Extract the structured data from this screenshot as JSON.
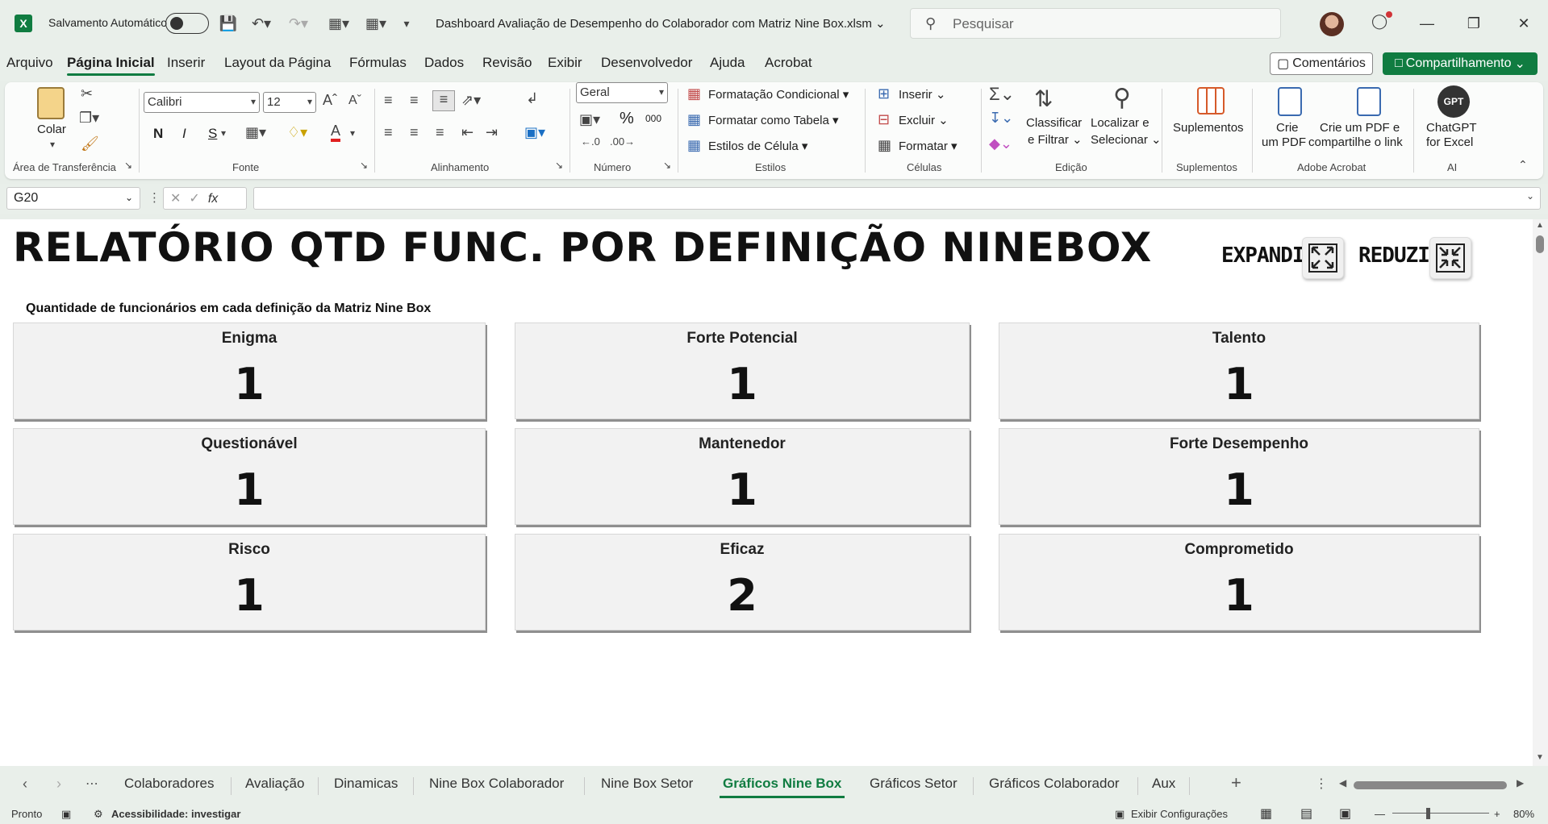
{
  "titlebar": {
    "autosave_label": "Salvamento Automático",
    "document_title": "Dashboard Avaliação de Desempenho do Colaborador com Matriz Nine Box.xlsm",
    "search_placeholder": "Pesquisar"
  },
  "menu": {
    "items": [
      "Arquivo",
      "Página Inicial",
      "Inserir",
      "Layout da Página",
      "Fórmulas",
      "Dados",
      "Revisão",
      "Exibir",
      "Desenvolvedor",
      "Ajuda",
      "Acrobat"
    ],
    "active": "Página Inicial",
    "comments_label": "Comentários",
    "share_label": "Compartilhamento"
  },
  "ribbon": {
    "clipboard": {
      "paste_label": "Colar",
      "group_label": "Área de Transferência"
    },
    "font": {
      "font_name": "Calibri",
      "font_size": "12",
      "bold": "N",
      "italic": "I",
      "underline": "S",
      "group_label": "Fonte"
    },
    "alignment": {
      "group_label": "Alinhamento"
    },
    "number": {
      "format": "Geral",
      "percent": "%",
      "thousands": "000",
      "group_label": "Número"
    },
    "styles": {
      "conditional": "Formatação Condicional",
      "as_table": "Formatar como Tabela",
      "cell_styles": "Estilos de Célula",
      "group_label": "Estilos"
    },
    "cells": {
      "insert": "Inserir",
      "delete": "Excluir",
      "format": "Formatar",
      "group_label": "Células"
    },
    "editing": {
      "sort_filter_1": "Classificar",
      "sort_filter_2": "e Filtrar",
      "find_1": "Localizar e",
      "find_2": "Selecionar",
      "group_label": "Edição"
    },
    "addins": {
      "label": "Suplementos",
      "group_label": "Suplementos"
    },
    "acrobat": {
      "create_pdf_1": "Crie",
      "create_pdf_2": "um PDF",
      "share_pdf_1": "Crie um PDF e",
      "share_pdf_2": "compartilhe o link",
      "group_label": "Adobe Acrobat"
    },
    "ai": {
      "icon_text": "GPT",
      "label_1": "ChatGPT",
      "label_2": "for Excel",
      "group_label": "AI"
    }
  },
  "formula_bar": {
    "name_box": "G20",
    "formula": ""
  },
  "sheet": {
    "title": "RELATÓRIO QTD FUNC. POR DEFINIÇÃO NINEBOX",
    "subtitle": "Quantidade de funcionários em cada definição da Matriz Nine Box",
    "expand_label": "EXPANDIR",
    "reduce_label": "REDUZIR",
    "cards": [
      {
        "label": "Enigma",
        "count": "1"
      },
      {
        "label": "Forte Potencial",
        "count": "1"
      },
      {
        "label": "Talento",
        "count": "1"
      },
      {
        "label": "Questionável",
        "count": "1"
      },
      {
        "label": "Mantenedor",
        "count": "1"
      },
      {
        "label": "Forte Desempenho",
        "count": "1"
      },
      {
        "label": "Risco",
        "count": "1"
      },
      {
        "label": "Eficaz",
        "count": "2"
      },
      {
        "label": "Comprometido",
        "count": "1"
      }
    ]
  },
  "tabs": {
    "items": [
      "Colaboradores",
      "Avaliação",
      "Dinamicas",
      "Nine Box Colaborador",
      "Nine Box Setor",
      "Gráficos Nine Box",
      "Gráficos Setor",
      "Gráficos Colaborador",
      "Aux"
    ],
    "active": "Gráficos Nine Box"
  },
  "status": {
    "ready": "Pronto",
    "accessibility": "Acessibilidade: investigar",
    "display_settings": "Exibir Configurações",
    "zoom": "80%"
  },
  "colors": {
    "excel_green": "#107c41",
    "card_bg": "#f2f2f2"
  }
}
